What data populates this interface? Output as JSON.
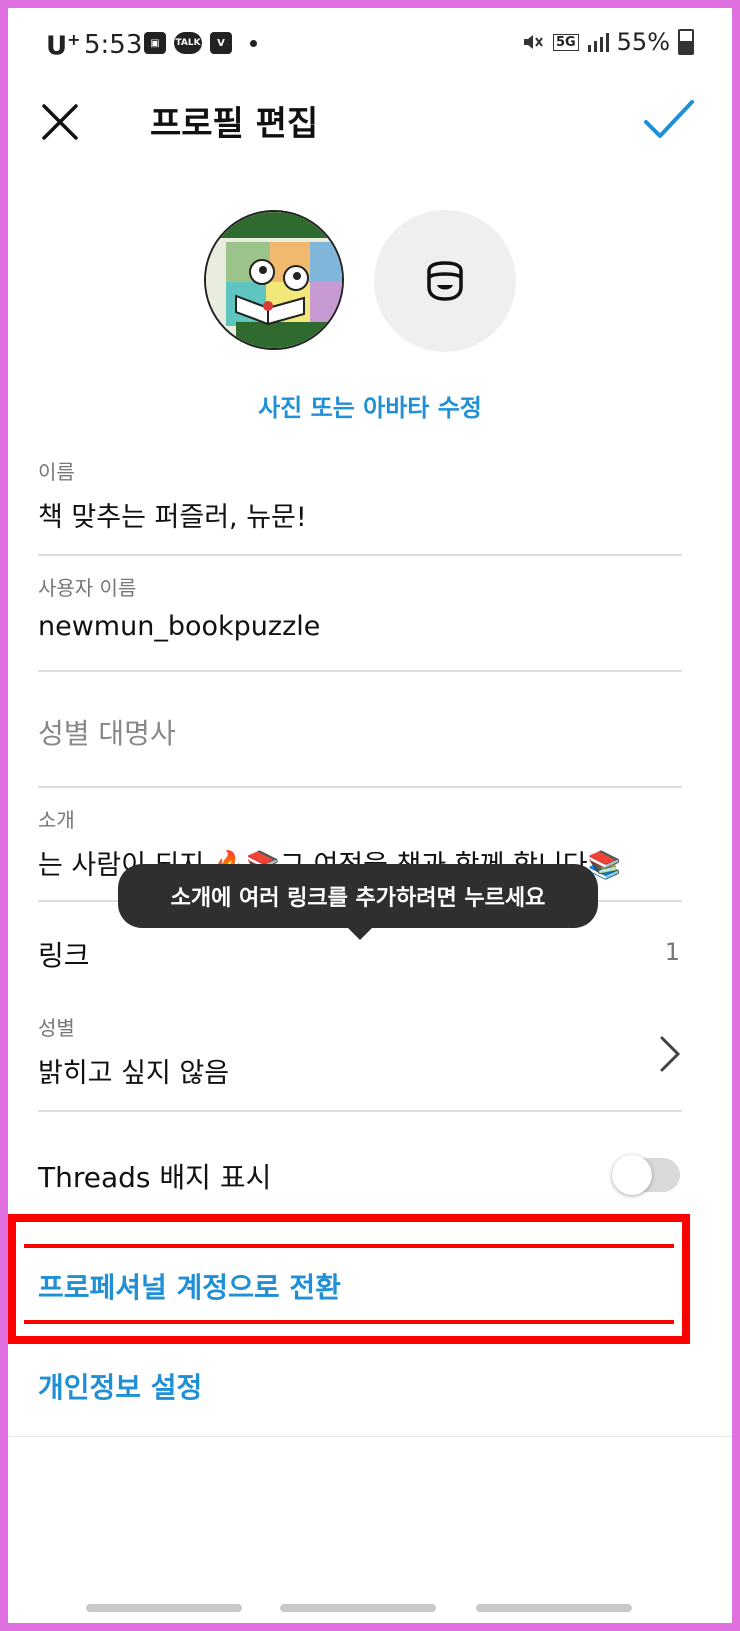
{
  "status_bar": {
    "carrier": "U",
    "carrier_sup": "+",
    "time": "5:53",
    "talk_label": "TALK",
    "network": "5G",
    "battery": "55%"
  },
  "header": {
    "title": "프로필 편집"
  },
  "avatar": {
    "edit_label": "사진 또는 아바타 수정"
  },
  "fields": {
    "name": {
      "label": "이름",
      "value": "책 맞추는 퍼즐러, 뉴문!"
    },
    "username": {
      "label": "사용자 이름",
      "value": "newmun_bookpuzzle"
    },
    "pronouns": {
      "placeholder": "성별 대명사"
    },
    "bio": {
      "label": "소개",
      "value": "는 사람이 되지 🔥📚그 여정을 책과 함께 합니다📚"
    },
    "links": {
      "label": "링크",
      "count": "1"
    },
    "gender": {
      "label": "성별",
      "value": "밝히고 싶지 않음"
    },
    "threads_badge": {
      "label": "Threads 배지 표시",
      "enabled": false
    }
  },
  "tooltip": {
    "text": "소개에 여러 링크를 추가하려면 누르세요"
  },
  "actions": {
    "switch_professional": "프로페셔널 계정으로 전환",
    "privacy_settings": "개인정보 설정"
  },
  "colors": {
    "accent": "#1f8fd6",
    "annotation": "#ff0000",
    "frame": "#e06fe0"
  }
}
